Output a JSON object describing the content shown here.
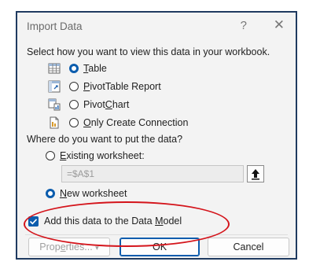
{
  "window": {
    "title": "Import Data",
    "help_glyph": "?",
    "close_glyph": "✕"
  },
  "view_section": {
    "prompt": "Select how you want to view this data in your workbook.",
    "options": [
      {
        "label": "Table",
        "accel": "T",
        "rest": "able",
        "selected": true,
        "icon": "table-icon"
      },
      {
        "label": "PivotTable Report",
        "accel": "P",
        "rest": "ivotTable Report",
        "selected": false,
        "icon": "pivottable-icon"
      },
      {
        "label": "PivotChart",
        "pre": "Pivot",
        "accel": "C",
        "rest": "hart",
        "selected": false,
        "icon": "pivotchart-icon"
      },
      {
        "label": "Only Create Connection",
        "accel": "O",
        "rest": "nly Create Connection",
        "selected": false,
        "icon": "connection-icon"
      }
    ]
  },
  "location_section": {
    "prompt": "Where do you want to put the data?",
    "existing": {
      "label": "Existing worksheet:",
      "accel": "E",
      "rest": "xisting worksheet:",
      "selected": false
    },
    "range_value": "=$A$1",
    "new": {
      "label": "New worksheet",
      "accel": "N",
      "rest": "ew worksheet",
      "selected": true
    }
  },
  "data_model": {
    "label": "Add this data to the Data Model",
    "accel": "M",
    "pre": "Add this data to the Data ",
    "rest": "odel",
    "checked": true
  },
  "buttons": {
    "properties": "Properties...",
    "properties_pre": "Prop",
    "properties_accel": "e",
    "properties_rest": "rties...",
    "ok": "OK",
    "cancel": "Cancel"
  },
  "colors": {
    "accent": "#0b5cad",
    "annotation": "#d4141b",
    "frame": "#1f3a60"
  }
}
